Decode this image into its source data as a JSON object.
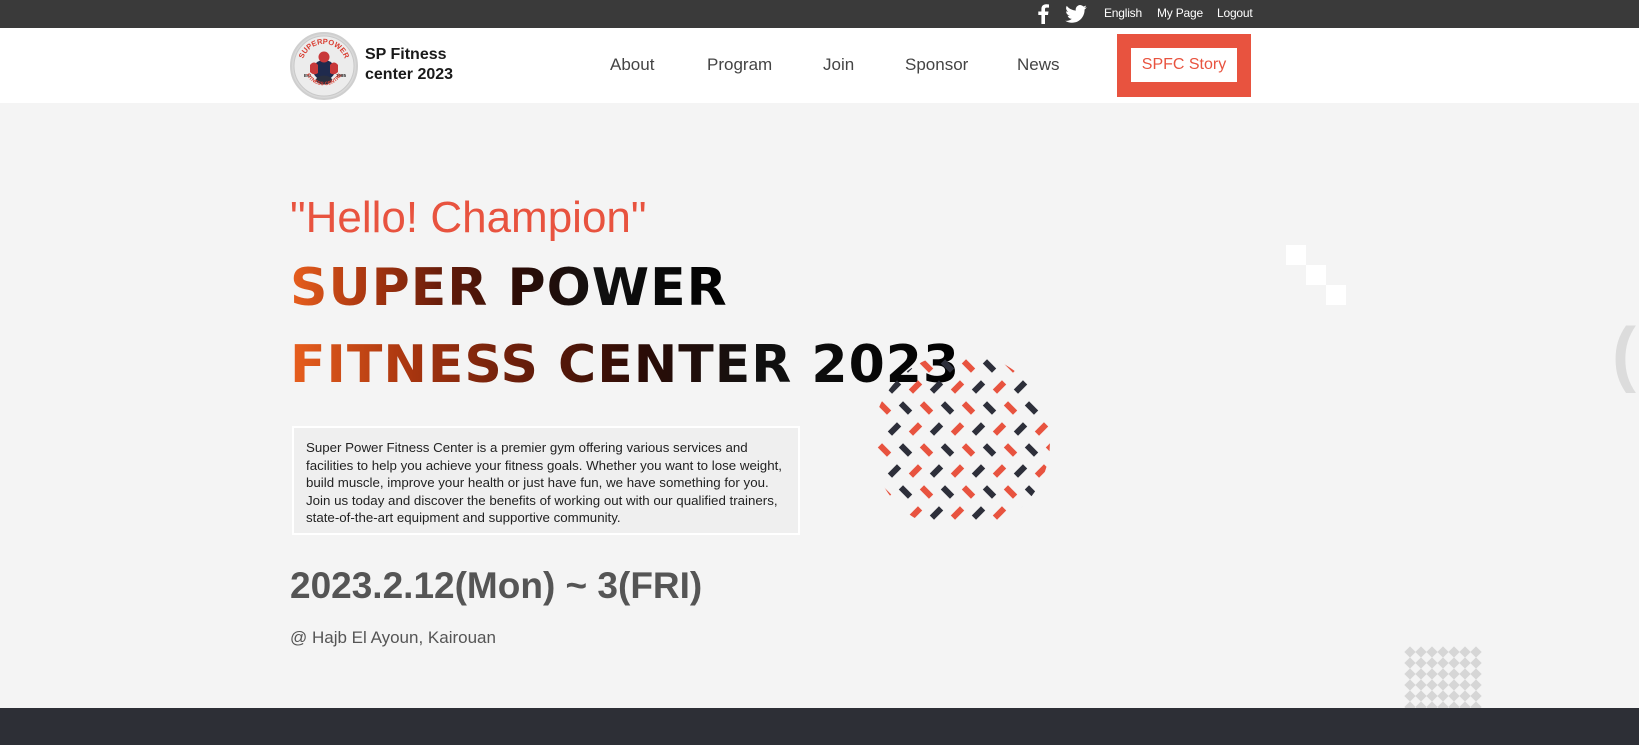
{
  "topbar": {
    "social": [
      "facebook-icon",
      "twitter-icon"
    ],
    "links": {
      "english": "English",
      "mypage": "My Page",
      "logout": "Logout"
    }
  },
  "header": {
    "brand_line1": "SP Fitness",
    "brand_line2": "center 2023",
    "logo": {
      "top_text": "SUPERPOWER",
      "bottom_text": "FITNESS CENTRE",
      "est": "Est",
      "year": "1985"
    },
    "nav": {
      "about": "About",
      "program": "Program",
      "join": "Join",
      "sponsor": "Sponsor",
      "news": "News"
    },
    "cta": "SPFC Story"
  },
  "hero": {
    "greeting": "\"Hello! Champion\"",
    "headline_1": "SUPER POWER",
    "headline_2": "FITNESS CENTER 2023",
    "description": "Super Power Fitness Center is a premier gym offering various services and facilities to help you achieve your fitness goals. Whether you want to lose weight, build muscle, improve your health or just have fun, we have something for you. Join us today and discover the benefits of working out with our qualified trainers, state-of-the-art equipment and supportive community.",
    "dates": "2023.2.12(Mon) ~ 3(FRI)",
    "location": "@ Hajb El Ayoun, Kairouan",
    "edge_text": "("
  },
  "colors": {
    "accent": "#e8533f",
    "topbar": "#3a3a3a",
    "footer_band": "#2d2f36",
    "pattern_dark": "#2d2f3a"
  }
}
